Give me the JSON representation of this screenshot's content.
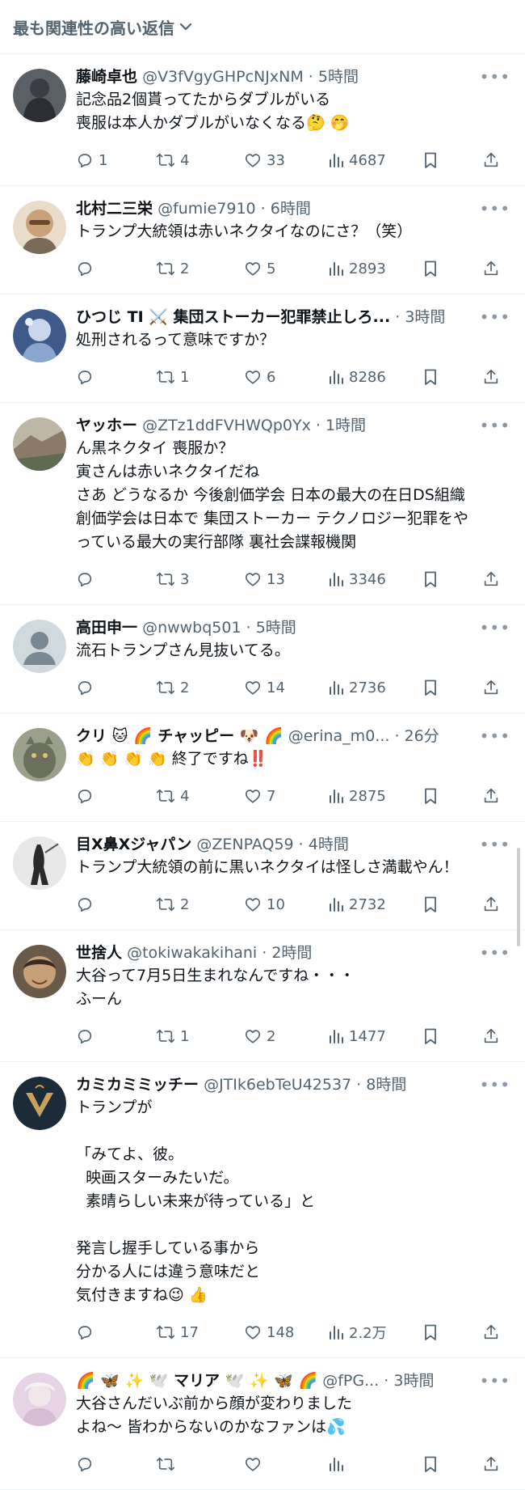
{
  "sort_header": {
    "label": "最も関連性の高い返信"
  },
  "tweets": [
    {
      "name": "藤崎卓也",
      "handle": "@V3fVgyGHPcNJxNM",
      "time": "5時間",
      "text": "記念品2個貰ってたからダブルがいる\n喪服は本人かダブルがいなくなる🤔 🤭",
      "replies": "1",
      "retweets": "4",
      "likes": "33",
      "views": "4687",
      "avatar_color": "#5b5f66"
    },
    {
      "name": "北村二三栄",
      "handle": "@fumie7910",
      "time": "6時間",
      "text": "トランプ大統領は赤いネクタイなのにさ？（笑）",
      "replies": "",
      "retweets": "2",
      "likes": "5",
      "views": "2893",
      "avatar_color": "#c9a27a"
    },
    {
      "name": "ひつじ TI ⚔️ 集団ストーカー犯罪禁止しろ...",
      "handle": "",
      "time": "3時間",
      "text": "処刑されるって意味ですか？",
      "replies": "",
      "retweets": "1",
      "likes": "6",
      "views": "8286",
      "avatar_color": "#3d5a8a"
    },
    {
      "name": "ヤッホー",
      "handle": "@ZTz1ddFVHWQp0Yx",
      "time": "1時間",
      "text": "ん黒ネクタイ 喪服か？\n寅さんは赤いネクタイだね\nさあ どうなるか 今後創価学会 日本の最大の在日DS組織\n創価学会は日本で 集団ストーカー テクノロジー犯罪をや\nっている最大の実行部隊 裏社会諜報機関",
      "replies": "",
      "retweets": "3",
      "likes": "13",
      "views": "3346",
      "avatar_color": "#8a7a66"
    },
    {
      "name": "高田申一",
      "handle": "@nwwbq501",
      "time": "5時間",
      "text": "流石トランプさん見抜いてる。",
      "replies": "",
      "retweets": "2",
      "likes": "14",
      "views": "2736",
      "avatar_color": "#cfd9de"
    },
    {
      "name": "クリ 🐱 🌈 チャッピー 🐶 🌈",
      "handle": "@erina_m0...",
      "time": "26分",
      "text": "👏 👏 👏 👏 終了ですね‼️",
      "replies": "",
      "retweets": "4",
      "likes": "7",
      "views": "2875",
      "avatar_color": "#6b6f5e"
    },
    {
      "name": "目X鼻Xジャパン",
      "handle": "@ZENPAQ59",
      "time": "4時間",
      "text": "トランプ大統領の前に黒いネクタイは怪しさ満載やん！",
      "replies": "",
      "retweets": "2",
      "likes": "10",
      "views": "2732",
      "avatar_color": "#e8e8e8"
    },
    {
      "name": "世捨人",
      "handle": "@tokiwakakihani",
      "time": "2時間",
      "text": "大谷って7月5日生まれなんですね・・・\nふーん",
      "replies": "",
      "retweets": "1",
      "likes": "2",
      "views": "1477",
      "avatar_color": "#c7a079"
    },
    {
      "name": "カミカミミッチー",
      "handle": "@JTIk6ebTeU42537",
      "time": "8時間",
      "text": "トランプが\n\n「みてよ、彼。\n  映画スターみたいだ。\n  素晴らしい未来が待っている」と\n\n発言し握手している事から\n分かる人には違う意味だと\n気付きますね😉 👍",
      "replies": "",
      "retweets": "17",
      "likes": "148",
      "views": "2.2万",
      "avatar_color": "#1c2b3a"
    },
    {
      "name": "🌈 🦋 ✨ 🕊️ マリア 🕊️ ✨ 🦋 🌈",
      "handle": "@fPG...",
      "time": "3時間",
      "text": "大谷さんだいぶ前から顔が変わりました\nよね〜 皆わからないのかなファンは💦",
      "replies": "",
      "retweets": "",
      "likes": "",
      "views": "",
      "avatar_color": "#e7d3e6"
    }
  ],
  "icons": {
    "reply": "reply-icon",
    "retweet": "retweet-icon",
    "like": "heart-icon",
    "views": "views-icon",
    "bookmark": "bookmark-icon",
    "share": "share-icon",
    "more": "more-icon",
    "chevron": "chevron-down-icon"
  }
}
